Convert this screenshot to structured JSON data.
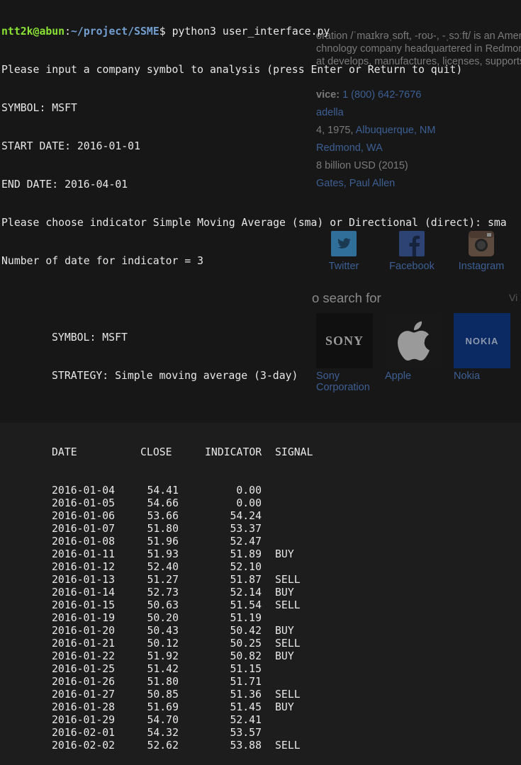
{
  "prompt": {
    "user_host": "ntt2k@abun",
    "separator": ":",
    "path": "~/project/SSME",
    "symbol": "$",
    "command": " python3 user_interface.py"
  },
  "lines": [
    "Please input a company symbol to analysis (press Enter or Return to quit)",
    "SYMBOL: MSFT",
    "START DATE: 2016-01-01",
    "END DATE: 2016-04-01",
    "Please choose indicator Simple Moving Average (sma) or Directional (direct): sma",
    "Number of date for indicator = 3"
  ],
  "report": {
    "symbol_line": "SYMBOL: MSFT",
    "strategy_line": "STRATEGY: Simple moving average (3-day)",
    "headers": {
      "date": "DATE",
      "close": "CLOSE",
      "indicator": "INDICATOR",
      "signal": "SIGNAL"
    },
    "rows": [
      {
        "date": "2016-01-04",
        "close": "54.41",
        "indicator": "0.00",
        "signal": ""
      },
      {
        "date": "2016-01-05",
        "close": "54.66",
        "indicator": "0.00",
        "signal": ""
      },
      {
        "date": "2016-01-06",
        "close": "53.66",
        "indicator": "54.24",
        "signal": ""
      },
      {
        "date": "2016-01-07",
        "close": "51.80",
        "indicator": "53.37",
        "signal": ""
      },
      {
        "date": "2016-01-08",
        "close": "51.96",
        "indicator": "52.47",
        "signal": ""
      },
      {
        "date": "2016-01-11",
        "close": "51.93",
        "indicator": "51.89",
        "signal": "BUY"
      },
      {
        "date": "2016-01-12",
        "close": "52.40",
        "indicator": "52.10",
        "signal": ""
      },
      {
        "date": "2016-01-13",
        "close": "51.27",
        "indicator": "51.87",
        "signal": "SELL"
      },
      {
        "date": "2016-01-14",
        "close": "52.73",
        "indicator": "52.14",
        "signal": "BUY"
      },
      {
        "date": "2016-01-15",
        "close": "50.63",
        "indicator": "51.54",
        "signal": "SELL"
      },
      {
        "date": "2016-01-19",
        "close": "50.20",
        "indicator": "51.19",
        "signal": ""
      },
      {
        "date": "2016-01-20",
        "close": "50.43",
        "indicator": "50.42",
        "signal": "BUY"
      },
      {
        "date": "2016-01-21",
        "close": "50.12",
        "indicator": "50.25",
        "signal": "SELL"
      },
      {
        "date": "2016-01-22",
        "close": "51.92",
        "indicator": "50.82",
        "signal": "BUY"
      },
      {
        "date": "2016-01-25",
        "close": "51.42",
        "indicator": "51.15",
        "signal": ""
      },
      {
        "date": "2016-01-26",
        "close": "51.80",
        "indicator": "51.71",
        "signal": ""
      },
      {
        "date": "2016-01-27",
        "close": "50.85",
        "indicator": "51.36",
        "signal": "SELL"
      },
      {
        "date": "2016-01-28",
        "close": "51.69",
        "indicator": "51.45",
        "signal": "BUY"
      },
      {
        "date": "2016-01-29",
        "close": "54.70",
        "indicator": "52.41",
        "signal": ""
      },
      {
        "date": "2016-02-01",
        "close": "54.32",
        "indicator": "53.57",
        "signal": ""
      },
      {
        "date": "2016-02-02",
        "close": "52.62",
        "indicator": "53.88",
        "signal": "SELL"
      }
    ]
  },
  "background_page": {
    "description_lines": [
      "oration /ˈmaɪkrəˌsɒft, -roʊ-, -ˌsɔːft/ is an Americ",
      "chnology company headquartered in Redmon",
      "at develops, manufactures, licenses, supports"
    ],
    "facts": [
      {
        "key": "vice:",
        "value": " 1 (800) 642-7676"
      },
      {
        "key": "",
        "value": "adella"
      },
      {
        "key": "",
        "value": " 4, 1975, ",
        "link": "Albuquerque, NM"
      },
      {
        "key": "",
        "value": "Redmond, WA"
      },
      {
        "key": "",
        "value": "8 billion USD (2015)"
      },
      {
        "key": "",
        "value": "Gates, Paul Allen"
      }
    ],
    "social": [
      {
        "label": "Twitter",
        "icon": "twitter-icon",
        "color": "#2f6f99"
      },
      {
        "label": "Facebook",
        "icon": "facebook-icon",
        "color": "#2d4373"
      },
      {
        "label": "Instagram",
        "icon": "instagram-icon",
        "color": "#5c4a3e"
      }
    ],
    "people_also_search": "o search for",
    "view_all": "Vi",
    "cards": [
      {
        "name": "Sony\nCorporation",
        "logo": "SONY",
        "tile_color": "#101010",
        "icon": "sony-logo"
      },
      {
        "name": "Apple",
        "logo": "",
        "tile_color": "#181818",
        "icon": "apple-logo-icon"
      },
      {
        "name": "Nokia",
        "logo": "NOKIA",
        "tile_color": "#0b2a63",
        "icon": "nokia-logo"
      }
    ]
  },
  "colors": {
    "prompt_user": "#8ae234",
    "prompt_path": "#729fcf",
    "text": "#e8e8e8",
    "link": "#3d5f94"
  }
}
